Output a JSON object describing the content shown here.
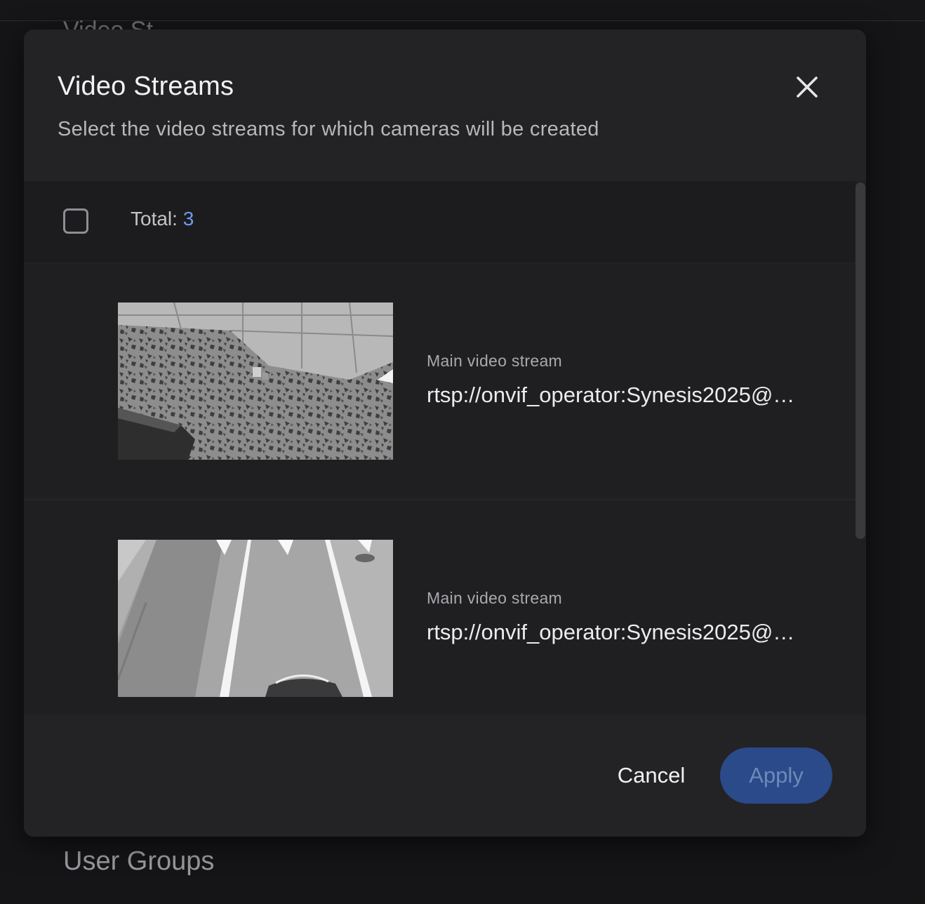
{
  "background": {
    "top_heading": "Video St",
    "bottom_heading": "User Groups"
  },
  "dialog": {
    "title": "Video Streams",
    "subtitle": "Select the video streams for which cameras will be created",
    "close_icon": "close-icon",
    "total_label": "Total:",
    "total_count": "3",
    "streams": [
      {
        "type": "Main video stream",
        "url": "rtsp://onvif_operator:Synesis2025@…"
      },
      {
        "type": "Main video stream",
        "url": "rtsp://onvif_operator:Synesis2025@…"
      }
    ],
    "cancel_label": "Cancel",
    "apply_label": "Apply"
  },
  "colors": {
    "accent": "#6b9bf0",
    "apply_bg": "#2a4a8a",
    "surface": "#232325"
  }
}
